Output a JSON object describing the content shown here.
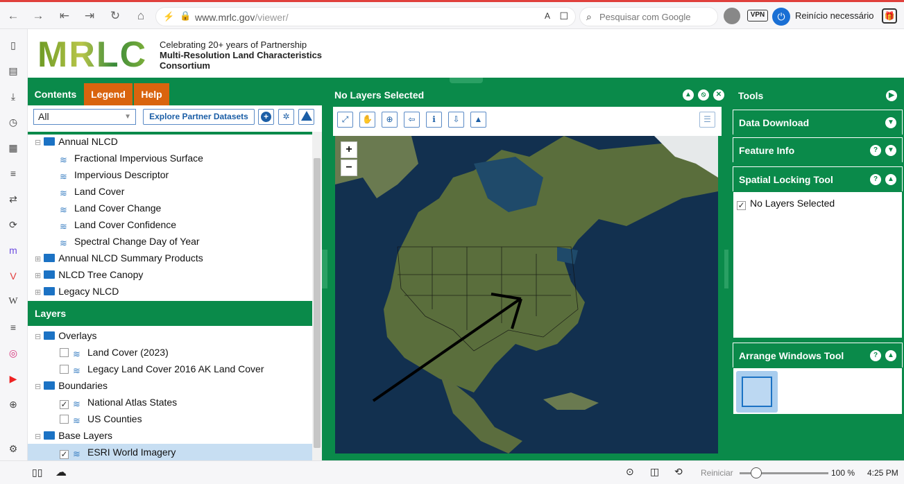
{
  "browser": {
    "url": "www.mrlc.gov",
    "url_path": "/viewer/",
    "search_placeholder": "Pesquisar com Google",
    "vpn": "VPN",
    "restart": "Reinício necessário",
    "status_reset": "Reiniciar",
    "zoom": "100 %",
    "time": "4:25 PM"
  },
  "header": {
    "logo": "MRLC",
    "line1": "Celebrating 20+ years of Partnership",
    "line2": "Multi-Resolution Land Characteristics",
    "line3": "Consortium"
  },
  "left": {
    "tabs": [
      "Contents",
      "Legend",
      "Help"
    ],
    "filter_value": "All",
    "explore": "Explore Partner Datasets",
    "tree": [
      {
        "label": "Annual NLCD",
        "type": "folder",
        "expanded": true
      },
      {
        "label": "Fractional Impervious Surface",
        "type": "layer"
      },
      {
        "label": "Impervious Descriptor",
        "type": "layer"
      },
      {
        "label": "Land Cover",
        "type": "layer"
      },
      {
        "label": "Land Cover Change",
        "type": "layer"
      },
      {
        "label": "Land Cover Confidence",
        "type": "layer"
      },
      {
        "label": "Spectral Change Day of Year",
        "type": "layer"
      },
      {
        "label": "Annual NLCD Summary Products",
        "type": "folder"
      },
      {
        "label": "NLCD Tree Canopy",
        "type": "folder"
      },
      {
        "label": "Legacy NLCD",
        "type": "folder"
      }
    ],
    "layers_title": "Layers",
    "layers": [
      {
        "label": "Overlays",
        "type": "folder"
      },
      {
        "label": "Land Cover (2023)",
        "type": "layer",
        "checked": false
      },
      {
        "label": "Legacy Land Cover 2016 AK Land Cover",
        "type": "layer",
        "checked": false
      },
      {
        "label": "Boundaries",
        "type": "folder"
      },
      {
        "label": "National Atlas States",
        "type": "layer",
        "checked": true
      },
      {
        "label": "US Counties",
        "type": "layer",
        "checked": false
      },
      {
        "label": "Base Layers",
        "type": "folder"
      },
      {
        "label": "ESRI World Imagery",
        "type": "layer",
        "checked": true,
        "selected": true
      }
    ]
  },
  "center": {
    "title": "No Layers Selected",
    "zoom_in": "+",
    "zoom_out": "−"
  },
  "right": {
    "tools": "Tools",
    "data_download": "Data Download",
    "feature_info": "Feature Info",
    "spatial_locking": "Spatial Locking Tool",
    "spatial_item": "No Layers Selected",
    "arrange": "Arrange Windows Tool"
  }
}
